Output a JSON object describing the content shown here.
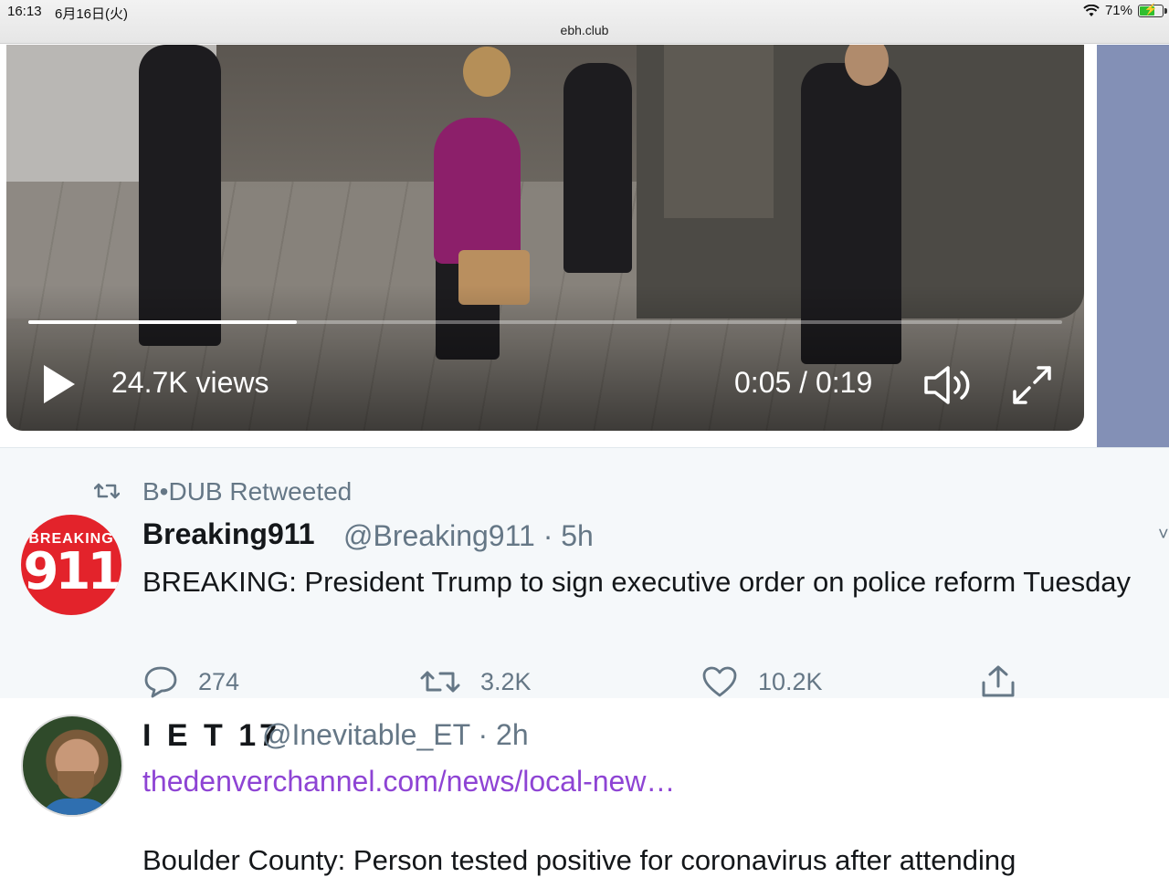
{
  "status_bar": {
    "time": "16:13",
    "date": "6月16日(火)",
    "url": "ebh.club",
    "battery": "71%",
    "battery_level": 0.71
  },
  "video": {
    "views": "24.7K views",
    "timecode": "0:05 / 0:19",
    "progress": 0.26
  },
  "tweet1": {
    "retweet_label": "B•DUB Retweeted",
    "name": "Breaking911",
    "meta": "@Breaking911 · 5h",
    "avatar_top": "BREAKING",
    "avatar_num": "911",
    "text": "BREAKING: President Trump to sign executive order on police reform Tuesday",
    "actions": {
      "reply_count": "274",
      "retweet_count": "3.2K",
      "like_count": "10.2K"
    }
  },
  "tweet2": {
    "name": "I E T 17",
    "meta": "@Inevitable_ET · 2h",
    "link": "thedenverchannel.com/news/local-new…",
    "text": "Boulder County: Person tested positive for coronavirus after attending"
  },
  "colors": {
    "link": "#8e44d4",
    "secondary_text": "#657786",
    "avatar_red": "#e3232b",
    "side_panel": "#8390b6"
  }
}
